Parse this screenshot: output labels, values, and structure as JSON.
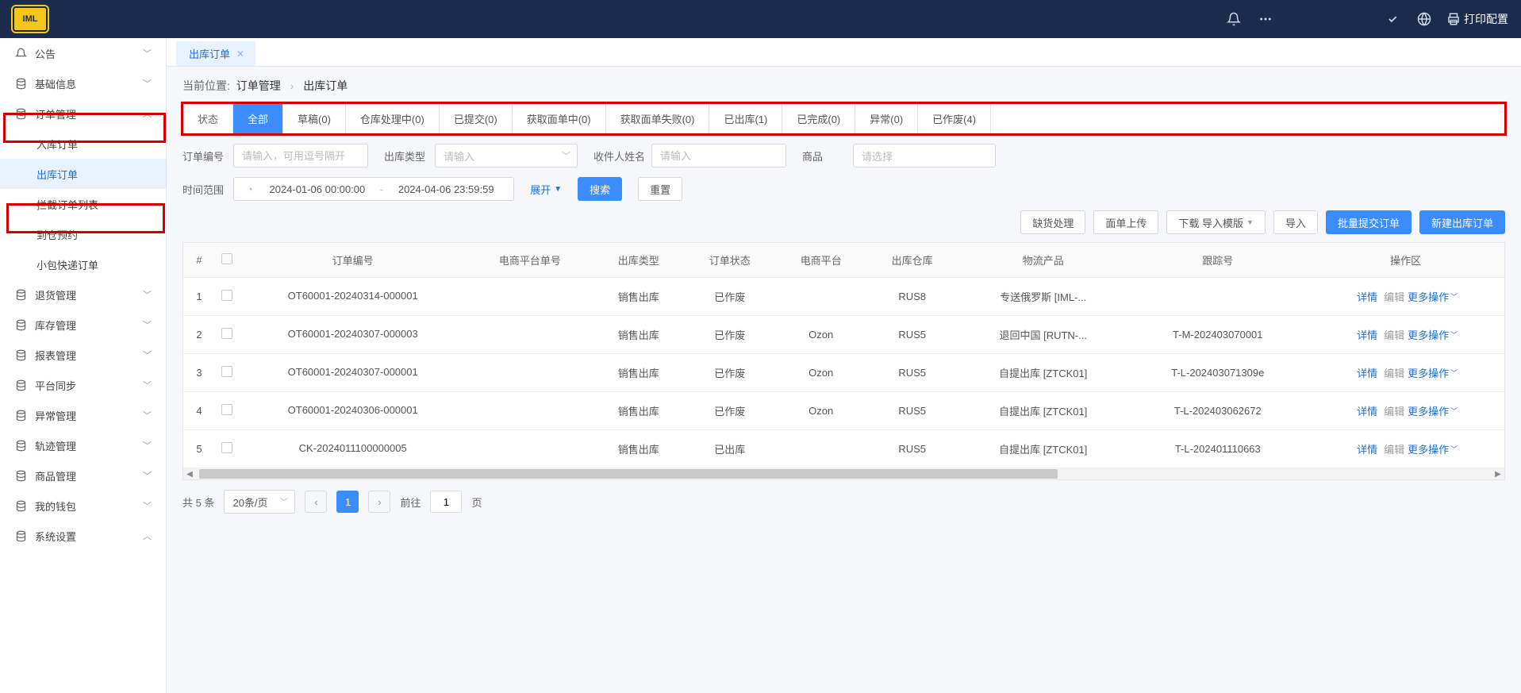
{
  "header": {
    "logo_text": "IML",
    "print_label": "打印配置"
  },
  "sidebar": {
    "items": [
      {
        "label": "公告",
        "icon": "bell",
        "expand": "down"
      },
      {
        "label": "基础信息",
        "icon": "db",
        "expand": "down"
      },
      {
        "label": "订单管理",
        "icon": "db",
        "expand": "up"
      },
      {
        "label": "入库订单",
        "level": 2
      },
      {
        "label": "出库订单",
        "level": 2,
        "active": true
      },
      {
        "label": "拦截订单列表",
        "level": 2
      },
      {
        "label": "到仓预约",
        "level": 2
      },
      {
        "label": "小包快递订单",
        "level": 2
      },
      {
        "label": "退货管理",
        "icon": "db",
        "expand": "down"
      },
      {
        "label": "库存管理",
        "icon": "db",
        "expand": "down"
      },
      {
        "label": "报表管理",
        "icon": "db",
        "expand": "down"
      },
      {
        "label": "平台同步",
        "icon": "db",
        "expand": "down"
      },
      {
        "label": "异常管理",
        "icon": "db",
        "expand": "down"
      },
      {
        "label": "轨迹管理",
        "icon": "db",
        "expand": "down"
      },
      {
        "label": "商品管理",
        "icon": "db",
        "expand": "down"
      },
      {
        "label": "我的钱包",
        "icon": "db",
        "expand": "down"
      },
      {
        "label": "系统设置",
        "icon": "db",
        "expand": "up"
      }
    ]
  },
  "tab": {
    "label": "出库订单"
  },
  "crumb": {
    "prefix": "当前位置:",
    "a": "订单管理",
    "b": "出库订单"
  },
  "status": {
    "head": "状态",
    "tabs": [
      "全部",
      "草稿(0)",
      "仓库处理中(0)",
      "已提交(0)",
      "获取面单中(0)",
      "获取面单失败(0)",
      "已出库(1)",
      "已完成(0)",
      "异常(0)",
      "已作废(4)"
    ]
  },
  "filters": {
    "order_no": {
      "label": "订单编号",
      "ph": "请输入，可用逗号隔开"
    },
    "out_type": {
      "label": "出库类型",
      "ph": "请输入"
    },
    "recv_name": {
      "label": "收件人姓名",
      "ph": "请输入"
    },
    "product": {
      "label": "商品",
      "ph": "请选择"
    },
    "time_range": {
      "label": "时间范围",
      "from": "2024-01-06 00:00:00",
      "to": "2024-04-06 23:59:59"
    },
    "expand": "展开",
    "search": "搜索",
    "reset": "重置"
  },
  "toolbar": {
    "short": "缺货处理",
    "upload": "面单上传",
    "tpl": "下载 导入模版",
    "import": "导入",
    "batch": "批量提交订单",
    "new": "新建出库订单"
  },
  "table": {
    "cols": [
      "#",
      "订单编号",
      "电商平台单号",
      "出库类型",
      "订单状态",
      "电商平台",
      "出库仓库",
      "物流产品",
      "跟踪号",
      "操作区"
    ],
    "rows": [
      {
        "n": "1",
        "order": "OT60001-20240314-000001",
        "plat_no": "",
        "type": "销售出库",
        "status": "已作废",
        "plat": "",
        "wh": "RUS8",
        "logi": "专送俄罗斯 [IML-...",
        "track": ""
      },
      {
        "n": "2",
        "order": "OT60001-20240307-000003",
        "plat_no": "",
        "type": "销售出库",
        "status": "已作废",
        "plat": "Ozon",
        "wh": "RUS5",
        "logi": "退回中国 [RUTN-...",
        "track": "T-M-202403070001"
      },
      {
        "n": "3",
        "order": "OT60001-20240307-000001",
        "plat_no": "",
        "type": "销售出库",
        "status": "已作废",
        "plat": "Ozon",
        "wh": "RUS5",
        "logi": "自提出库 [ZTCK01]",
        "track": "T-L-202403071309е"
      },
      {
        "n": "4",
        "order": "OT60001-20240306-000001",
        "plat_no": "",
        "type": "销售出库",
        "status": "已作废",
        "plat": "Ozon",
        "wh": "RUS5",
        "logi": "自提出库 [ZTCK01]",
        "track": "T-L-202403062672"
      },
      {
        "n": "5",
        "order": "CK-2024011100000005",
        "plat_no": "",
        "type": "销售出库",
        "status": "已出库",
        "plat": "",
        "wh": "RUS5",
        "logi": "自提出库 [ZTCK01]",
        "track": "T-L-202401110663"
      }
    ],
    "actions": {
      "detail": "详情",
      "edit": "编辑",
      "more": "更多操作"
    }
  },
  "pager": {
    "total": "共 5 条",
    "size": "20条/页",
    "page": "1",
    "goto": "前往",
    "unit": "页"
  }
}
